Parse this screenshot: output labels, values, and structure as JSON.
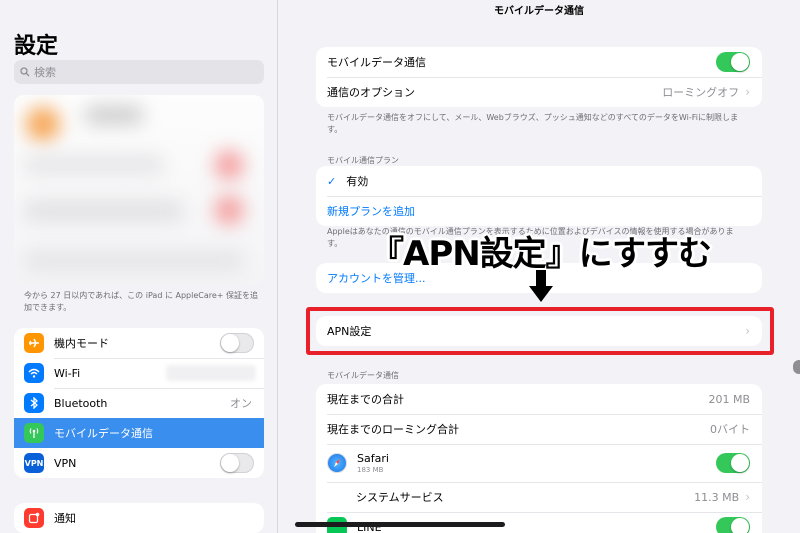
{
  "sidebar": {
    "title": "設定",
    "search_placeholder": "検索",
    "applecare_note": "今から 27 日以内であれば、この iPad に AppleCare+ 保証を追加できます。",
    "items": [
      {
        "label": "機内モード",
        "icon": "airplane-icon",
        "color": "#ff9500",
        "control": "toggle-off"
      },
      {
        "label": "Wi-Fi",
        "icon": "wifi-icon",
        "color": "#007aff",
        "control": "blurred"
      },
      {
        "label": "Bluetooth",
        "icon": "bluetooth-icon",
        "color": "#007aff",
        "value": "オン"
      },
      {
        "label": "モバイルデータ通信",
        "icon": "antenna-icon",
        "color": "#34c759",
        "selected": true
      },
      {
        "label": "VPN",
        "icon": "vpn-icon",
        "color": "#0a60d8",
        "icon_text": "VPN",
        "control": "toggle-off"
      }
    ],
    "notifications": {
      "label": "通知",
      "icon": "notification-icon",
      "color": "#ff3b30"
    }
  },
  "main": {
    "title": "モバイルデータ通信",
    "top_card": {
      "mobile_data": "モバイルデータ通信",
      "options_label": "通信のオプション",
      "options_value": "ローミングオフ"
    },
    "top_note": "モバイルデータ通信をオフにして、メール、Webブラウズ、プッシュ通知などのすべてのデータをWi-Fiに制限します。",
    "plan_header": "モバイル通信プラン",
    "plan_card": {
      "active": "有効",
      "add_plan": "新規プランを追加"
    },
    "plan_note": "Appleはあなたの通信のモバイル通信プランを表示するために位置およびデバイスの情報を使用する場合があります。",
    "manage_account": "アカウントを管理...",
    "apn": "APN設定",
    "usage_header": "モバイルデータ通信",
    "usage": {
      "total_label": "現在までの合計",
      "total_value": "201 MB",
      "roaming_label": "現在までのローミング合計",
      "roaming_value": "0バイト",
      "safari_label": "Safari",
      "safari_size": "183 MB",
      "system_label": "システムサービス",
      "system_value": "11.3 MB",
      "line_label": "LINE"
    }
  },
  "annotation": {
    "text": "『APN設定』にすすむ",
    "box_color": "#e8202a"
  },
  "colors": {
    "accent": "#007aff",
    "toggle_on": "#34c759",
    "selected_row": "#3a8eee"
  }
}
